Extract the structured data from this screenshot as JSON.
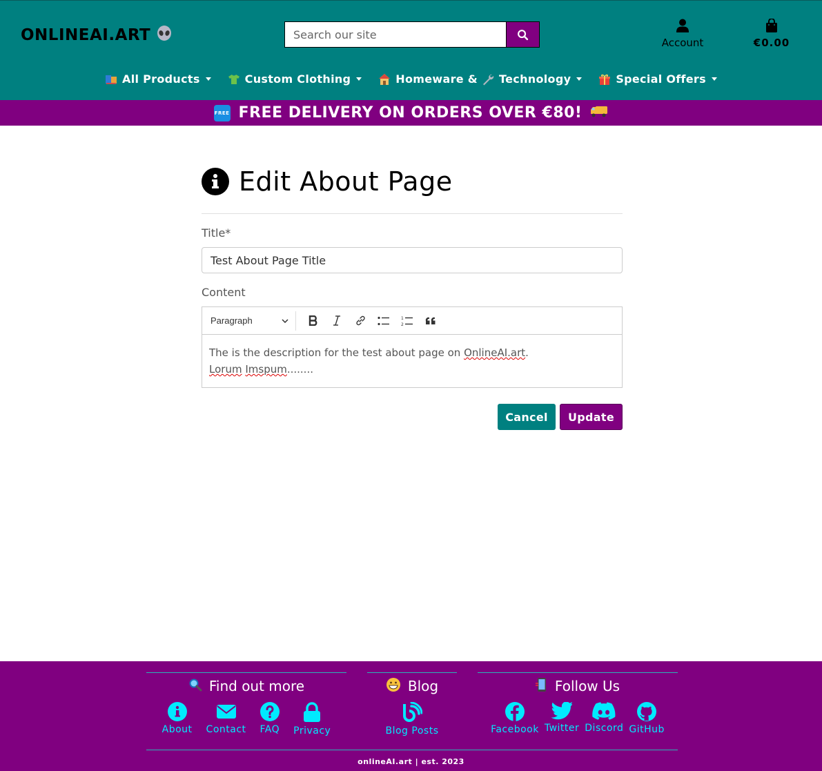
{
  "header": {
    "logo": "ONLINEAI.ART",
    "search_placeholder": "Search our site",
    "account_label": "Account",
    "cart_total": "€0.00"
  },
  "nav": {
    "items": [
      {
        "label": "All Products",
        "icon": "books-emoji"
      },
      {
        "label": "Custom Clothing",
        "icon": "tshirt-emoji"
      },
      {
        "label": "Homeware & ",
        "label2": "Technology",
        "icon": "house-emoji"
      },
      {
        "label": "Special Offers",
        "icon": "gift-emoji"
      }
    ]
  },
  "banner": {
    "badge": "FREE",
    "text": "FREE DELIVERY ON ORDERS OVER €80!"
  },
  "main": {
    "page_title": "Edit About Page",
    "title_label": "Title*",
    "title_value": "Test About Page Title",
    "content_label": "Content",
    "editor": {
      "paragraph_select": "Paragraph",
      "body_line1_prefix": "The is the description for the test about page on ",
      "body_line1_link": "OnlineAI.art",
      "body_line1_suffix": ".",
      "body_line2_word": "Lorum",
      "body_line2_space": " ",
      "body_line2_word2": "Imspum",
      "body_line2_suffix": "........"
    },
    "cancel_label": "Cancel",
    "update_label": "Update"
  },
  "footer": {
    "find_out_more": {
      "heading": "Find out more",
      "links": [
        "About",
        "Contact",
        "FAQ",
        "Privacy"
      ]
    },
    "blog": {
      "heading": "Blog",
      "links": [
        "Blog Posts"
      ]
    },
    "follow_us": {
      "heading": "Follow Us",
      "links": [
        "Facebook",
        "Twitter",
        "Discord",
        "GitHub"
      ]
    },
    "copyright": "onlineAI.art | est. 2023"
  },
  "colors": {
    "teal": "#008080",
    "purple": "#800080",
    "footer_link": "#00eaff"
  }
}
